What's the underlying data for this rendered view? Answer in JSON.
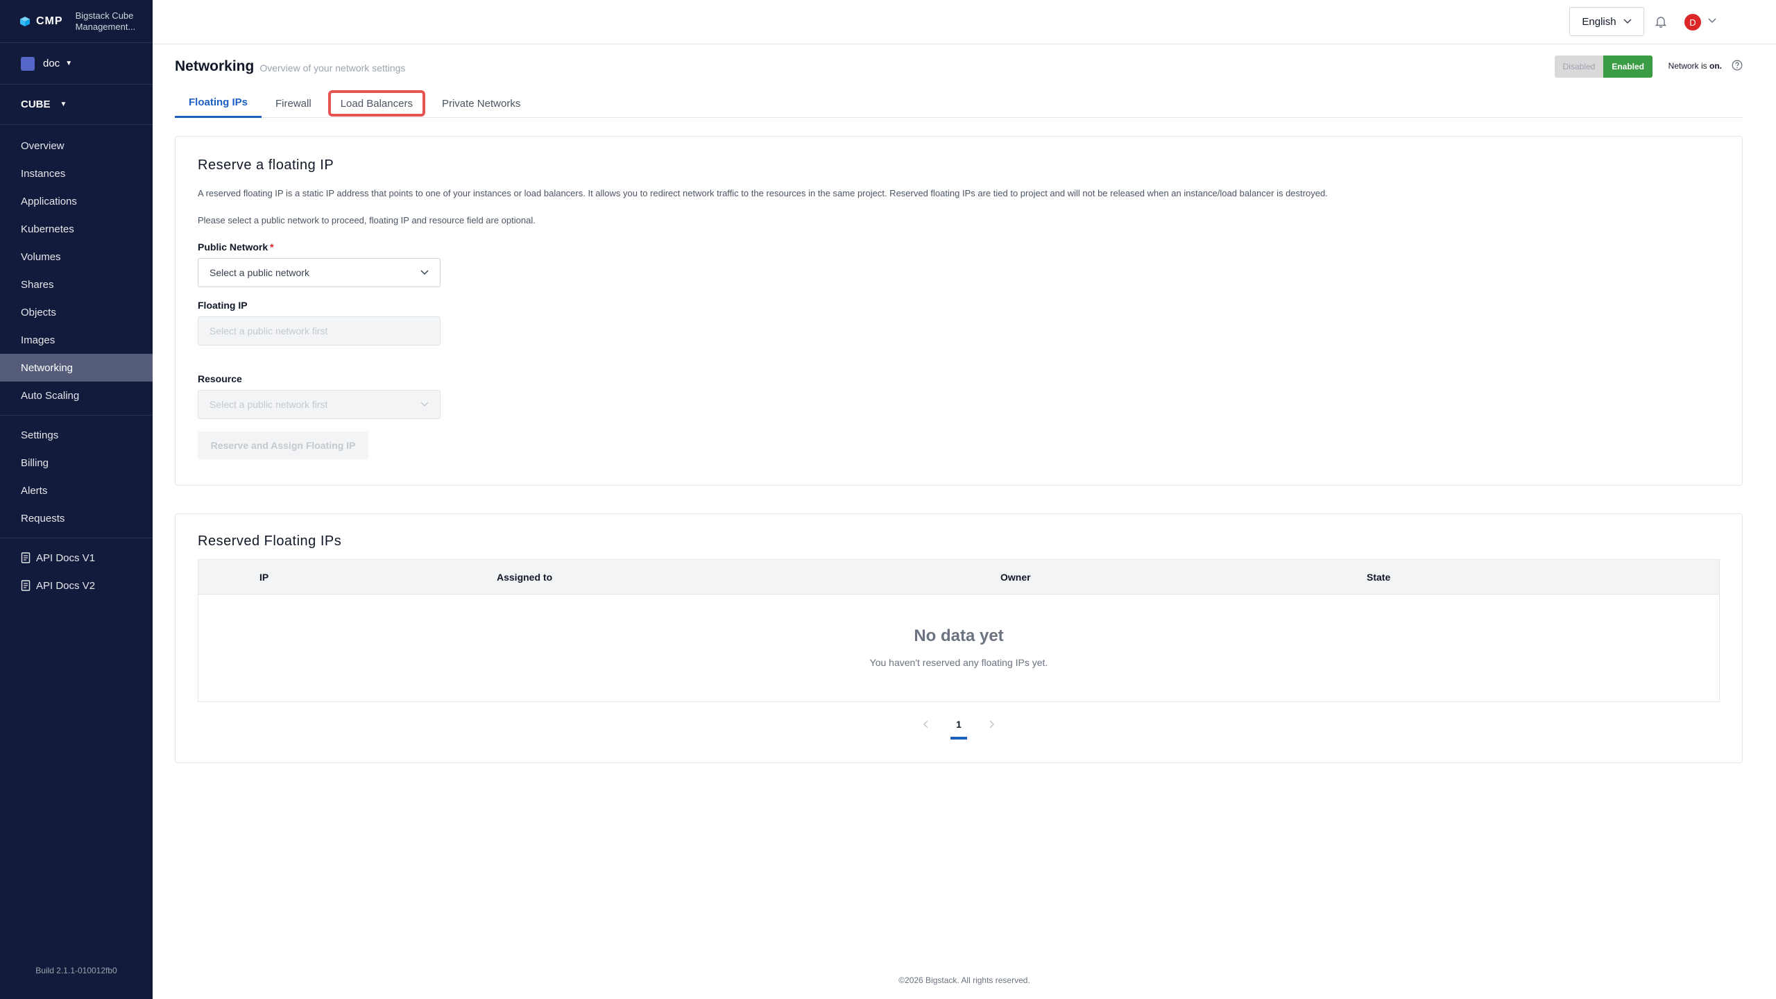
{
  "sidebar": {
    "brand": "CMP",
    "app_name": "Bigstack Cube Management...",
    "project": "doc",
    "region": "CUBE",
    "nav": [
      "Overview",
      "Instances",
      "Applications",
      "Kubernetes",
      "Volumes",
      "Shares",
      "Objects",
      "Images",
      "Networking",
      "Auto Scaling"
    ],
    "nav2": [
      "Settings",
      "Billing",
      "Alerts",
      "Requests"
    ],
    "docs": [
      "API Docs V1",
      "API Docs V2"
    ],
    "build": "Build 2.1.1-010012fb0"
  },
  "header": {
    "language": "English",
    "avatar_letter": "D"
  },
  "page": {
    "title": "Networking",
    "subtitle": "Overview of your network settings",
    "toggle_disabled": "Disabled",
    "toggle_enabled": "Enabled",
    "status_prefix": "Network is ",
    "status_value": "on."
  },
  "tabs": [
    "Floating IPs",
    "Firewall",
    "Load Balancers",
    "Private Networks"
  ],
  "reserve": {
    "title": "Reserve a floating IP",
    "desc1": "A reserved floating IP is a static IP address that points to one of your instances or load balancers. It allows you to redirect network traffic to the resources in the same project. Reserved floating IPs are tied to project and will not be released when an instance/load balancer is destroyed.",
    "desc2": "Please select a public network to proceed, floating IP and resource field are optional.",
    "public_network_label": "Public Network",
    "public_network_placeholder": "Select a public network",
    "floating_ip_label": "Floating IP",
    "floating_ip_placeholder": "Select a public network first",
    "resource_label": "Resource",
    "resource_placeholder": "Select a public network first",
    "submit_label": "Reserve and Assign Floating IP"
  },
  "reserved": {
    "title": "Reserved Floating IPs",
    "columns": [
      "IP",
      "Assigned to",
      "Owner",
      "State"
    ],
    "empty_title": "No data yet",
    "empty_sub": "You haven't reserved any floating IPs yet.",
    "page": "1"
  },
  "footer": "©2026 Bigstack. All rights reserved.",
  "colors": {
    "sidebar_bg": "#121b3b",
    "accent": "#1d5fc4",
    "enabled": "#3a9d45",
    "highlight": "#e55353"
  }
}
